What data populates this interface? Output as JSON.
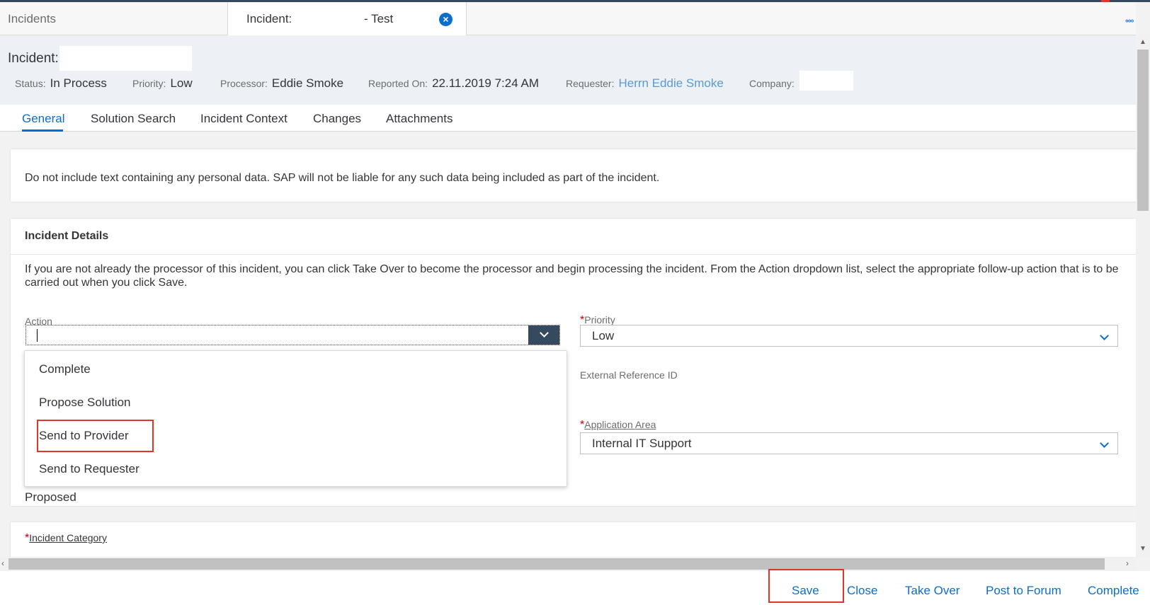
{
  "tabs": {
    "list_label": "Incidents",
    "current_prefix": "Incident:",
    "current_suffix": "- Test",
    "close_icon": "close-icon",
    "overflow": "°°°"
  },
  "header": {
    "title_prefix": "Incident:",
    "attributes": [
      {
        "label": "Status:",
        "value": "In Process"
      },
      {
        "label": "Priority:",
        "value": "Low"
      },
      {
        "label": "Processor:",
        "value": "Eddie Smoke"
      },
      {
        "label": "Reported On:",
        "value": "22.11.2019 7:24 AM"
      },
      {
        "label": "Requester:",
        "value": "Herrn Eddie Smoke"
      },
      {
        "label": "Company:",
        "value": ""
      }
    ]
  },
  "nav": {
    "tabs": [
      "General",
      "Solution Search",
      "Incident Context",
      "Changes",
      "Attachments"
    ],
    "active": "General"
  },
  "notice": "Do not include text containing any personal data. SAP will not be liable for any such data being included as part of the incident.",
  "details": {
    "title": "Incident Details",
    "description": "If you are not already the processor of this incident, you can click Take Over to become the processor and begin processing the incident. From the Action dropdown list, select the appropriate follow-up action that is to be carried out when you click Save.",
    "action_label": "Action",
    "action_value": "",
    "action_options": [
      "Complete",
      "Propose Solution",
      "Send to Provider",
      "Send to Requester"
    ],
    "highlighted_option": "Send to Provider",
    "priority_label": "Priority",
    "priority_value": "Low",
    "external_ref_label": "External Reference ID",
    "app_area_label": "Application Area",
    "app_area_value": "Internal IT Support",
    "proposed_text": "Proposed",
    "category_label": "Incident Category",
    "required_marker": "*"
  },
  "footer": {
    "buttons": [
      "Save",
      "Close",
      "Take Over",
      "Post to Forum",
      "Complete"
    ],
    "highlighted": "Save"
  },
  "colors": {
    "accent": "#0a6ed1",
    "highlight": "#e0352b",
    "shell": "#354a5f",
    "required": "#bb0000"
  }
}
